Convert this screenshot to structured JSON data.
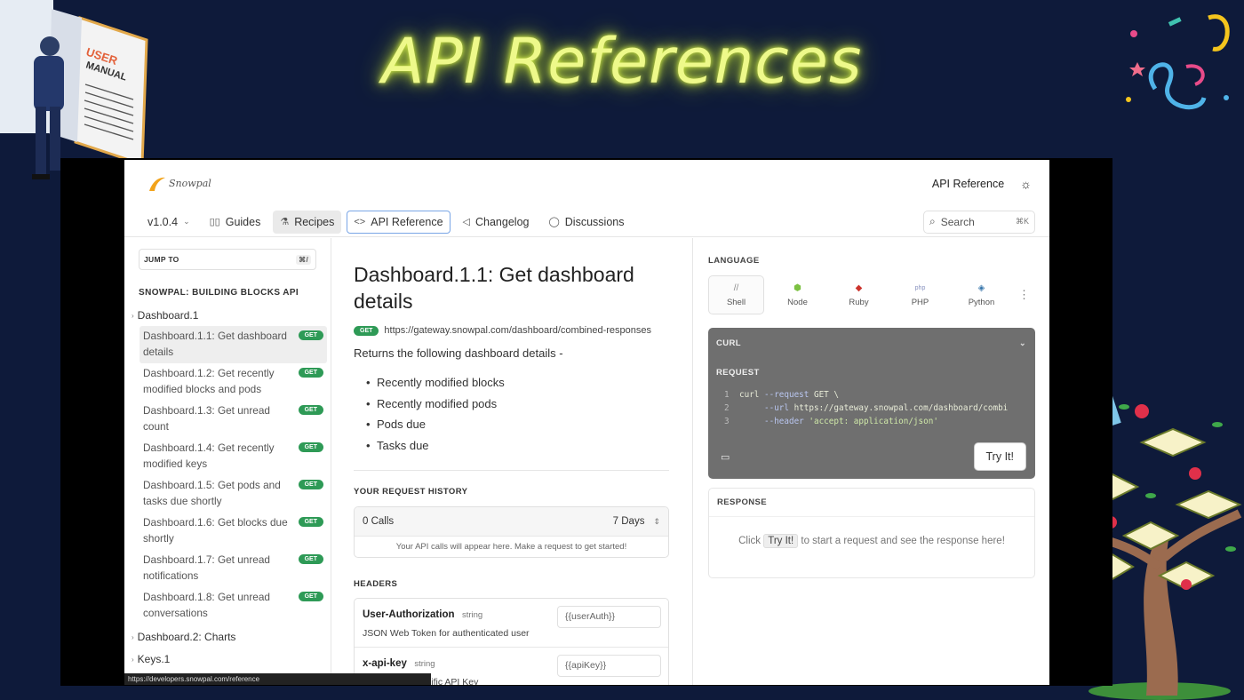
{
  "banner": {
    "title": "API References",
    "manual_text": [
      "USER",
      "MANUAL"
    ]
  },
  "app": {
    "logo_text": "Snowpal",
    "topbar": {
      "title": "API Reference",
      "theme_icon": "sun-icon"
    },
    "nav": {
      "version": "v1.0.4",
      "items": [
        {
          "label": "Guides",
          "icon": "book-icon"
        },
        {
          "label": "Recipes",
          "icon": "flask-icon"
        },
        {
          "label": "API Reference",
          "icon": "code-icon"
        },
        {
          "label": "Changelog",
          "icon": "megaphone-icon"
        },
        {
          "label": "Discussions",
          "icon": "chat-icon"
        }
      ],
      "search_label": "Search",
      "search_shortcut": "⌘K"
    },
    "sidebar": {
      "jump_label": "JUMP TO",
      "jump_shortcut": "⌘/",
      "heading": "SNOWPAL: BUILDING BLOCKS API",
      "group_open": "Dashboard.1",
      "items": [
        {
          "label": "Dashboard.1.1: Get dashboard details",
          "method": "GET"
        },
        {
          "label": "Dashboard.1.2: Get recently modified blocks and pods",
          "method": "GET"
        },
        {
          "label": "Dashboard.1.3: Get unread count",
          "method": "GET"
        },
        {
          "label": "Dashboard.1.4: Get recently modified keys",
          "method": "GET"
        },
        {
          "label": "Dashboard.1.5: Get pods and tasks due shortly",
          "method": "GET"
        },
        {
          "label": "Dashboard.1.6: Get blocks due shortly",
          "method": "GET"
        },
        {
          "label": "Dashboard.1.7: Get unread notifications",
          "method": "GET"
        },
        {
          "label": "Dashboard.1.8: Get unread conversations",
          "method": "GET"
        }
      ],
      "groups_closed": [
        "Dashboard.2: Charts",
        "Keys.1"
      ],
      "status_url": "https://developers.snowpal.com/reference"
    },
    "main": {
      "title": "Dashboard.1.1: Get dashboard details",
      "method": "GET",
      "url": "https://gateway.snowpal.com/dashboard/combined-responses",
      "description": "Returns the following dashboard details -",
      "bullets": [
        "Recently modified blocks",
        "Recently modified pods",
        "Pods due",
        "Tasks due"
      ],
      "history": {
        "label": "YOUR REQUEST HISTORY",
        "calls": "0 Calls",
        "range": "7 Days",
        "note": "Your API calls will appear here. Make a request to get started!"
      },
      "headers": {
        "label": "HEADERS",
        "rows": [
          {
            "name": "User-Authorization",
            "type": "string",
            "desc": "JSON Web Token for authenticated user",
            "value": "{{userAuth}}"
          },
          {
            "name": "x-api-key",
            "type": "string",
            "desc": "cific API Key",
            "value": "{{apiKey}}"
          }
        ]
      }
    },
    "right": {
      "language_label": "LANGUAGE",
      "languages": [
        {
          "name": "Shell",
          "icon": "//"
        },
        {
          "name": "Node",
          "icon": "⬢"
        },
        {
          "name": "Ruby",
          "icon": "◆"
        },
        {
          "name": "PHP",
          "icon": "php"
        },
        {
          "name": "Python",
          "icon": "◈"
        }
      ],
      "curl_label": "CURL",
      "request_label": "REQUEST",
      "code": {
        "l1_num": "1",
        "l1_cmd": "curl",
        "l1_flag": "--request",
        "l1_rest": " GET \\",
        "l2_num": "2",
        "l2_flag": "--url",
        "l2_rest": " https://gateway.snowpal.com/dashboard/combi",
        "l3_num": "3",
        "l3_flag": "--header",
        "l3_str": "'accept: application/json'"
      },
      "try_label": "Try It!",
      "response_label": "RESPONSE",
      "response_pre": "Click",
      "response_chip": "Try It!",
      "response_post": "to start a request and see the response here!"
    }
  }
}
